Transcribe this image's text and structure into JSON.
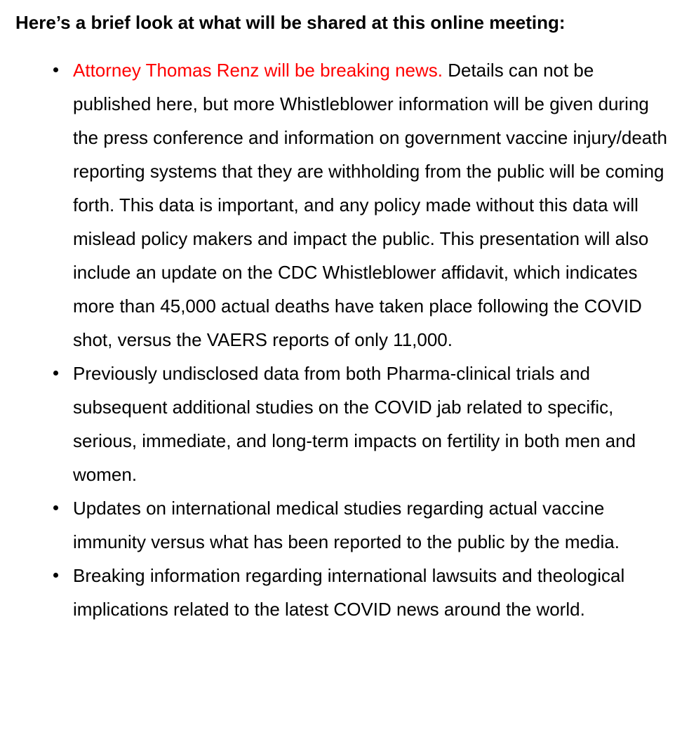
{
  "heading": "Here’s a brief look at what will be shared at this online meeting:",
  "colors": {
    "text": "#000000",
    "highlight": "#ff0000",
    "background": "#ffffff"
  },
  "bullets": [
    {
      "highlight": "Attorney Thomas Renz will be breaking news.",
      "text": " Details can not be published here, but more Whistleblower information will be given during the press conference and information on government vaccine injury/death reporting systems that they are withholding from the public will be coming forth. This data is important, and any policy made without this data will mislead policy makers and impact the public. This presentation will also include an update on the CDC Whistleblower affidavit, which indicates more than 45,000 actual deaths have taken place following the COVID shot, versus the VAERS reports of only 11,000."
    },
    {
      "text": "Previously undisclosed data from both Pharma-clinical trials and subsequent additional studies on the COVID jab related to specific, serious, immediate, and long-term impacts on fertility in both men and women."
    },
    {
      "text": "Updates on international medical studies regarding actual vaccine immunity versus what has been reported to the public by the media."
    },
    {
      "text": "Breaking information regarding international lawsuits and theological implications related to the latest COVID news around the world."
    }
  ]
}
